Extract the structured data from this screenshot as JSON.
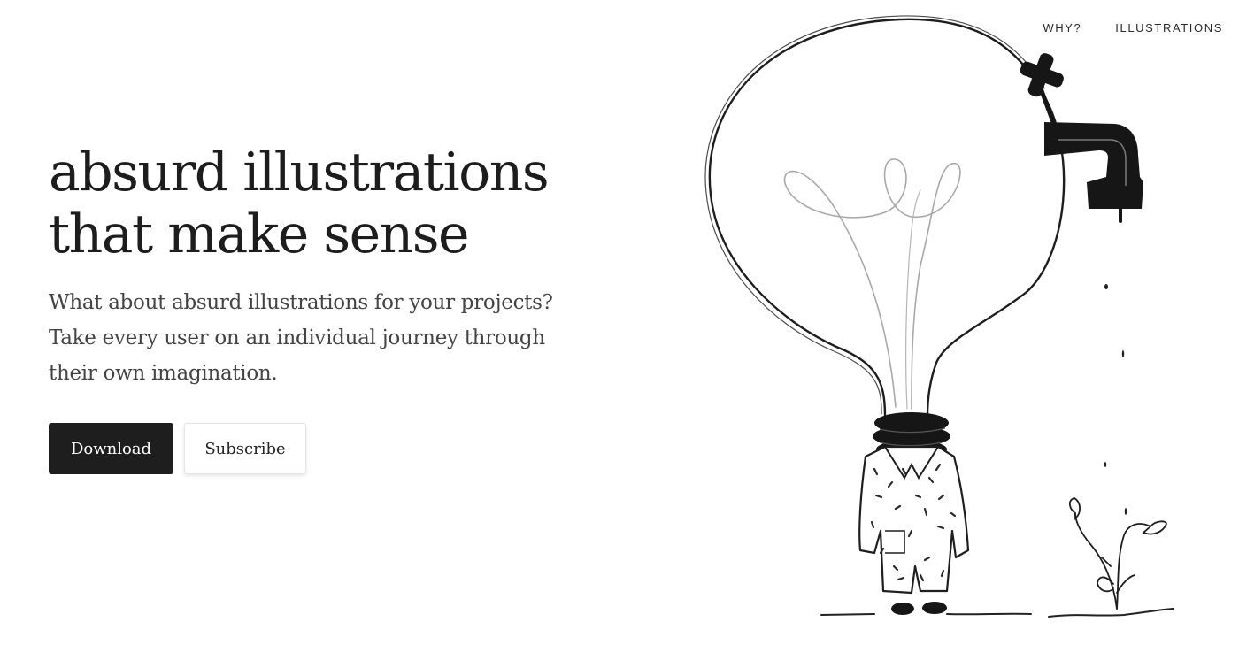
{
  "nav": {
    "items": [
      {
        "label": "WHY?"
      },
      {
        "label": "ILLUSTRATIONS"
      }
    ]
  },
  "hero": {
    "title_lines": [
      "absurd illustrations",
      "that make sense"
    ],
    "description_lines": [
      "What about absurd illustrations for your projects?",
      "Take every user on an individual journey through",
      "their own imagination."
    ]
  },
  "actions": {
    "download_label": "Download",
    "subscribe_label": "Subscribe"
  },
  "colors": {
    "primary_button": "#1e1e1e",
    "text": "#222222",
    "background": "#ffffff"
  },
  "illustration": {
    "icons": [
      "lightbulb-person-icon",
      "faucet-icon",
      "water-drop-icon",
      "sprout-icon"
    ]
  }
}
